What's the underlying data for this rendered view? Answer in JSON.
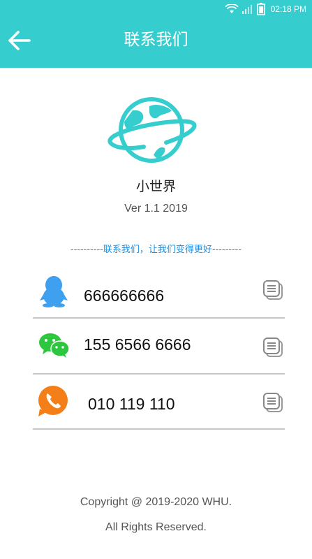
{
  "status_bar": {
    "time": "02:18 PM",
    "icons": [
      "wifi-icon",
      "signal-icon",
      "battery-icon"
    ]
  },
  "app_bar": {
    "title": "联系我们",
    "back_icon": "arrow-left-icon",
    "background": "#35cdce"
  },
  "about": {
    "logo_icon": "planet-globe-icon",
    "app_name": "小世界",
    "version": "Ver 1.1 2019",
    "slogan": "----------联系我们，让我们变得更好---------"
  },
  "contacts": [
    {
      "icon": "qq-penguin-icon",
      "value": "666666666",
      "copy_icon": "copy-icon"
    },
    {
      "icon": "wechat-icon",
      "value": "155 6566 6666",
      "copy_icon": "copy-icon"
    },
    {
      "icon": "phone-icon",
      "value": "010 119 110",
      "copy_icon": "copy-icon"
    }
  ],
  "footer": {
    "copyright": "Copyright @ 2019-2020 WHU.",
    "rights": "All Rights Reserved."
  },
  "colors": {
    "accent": "#35cdce",
    "slogan": "#1a8fe0",
    "qq": "#3fa0f0",
    "wechat": "#2dc63f",
    "phone": "#f47e17",
    "divider": "#c8c8c8"
  }
}
